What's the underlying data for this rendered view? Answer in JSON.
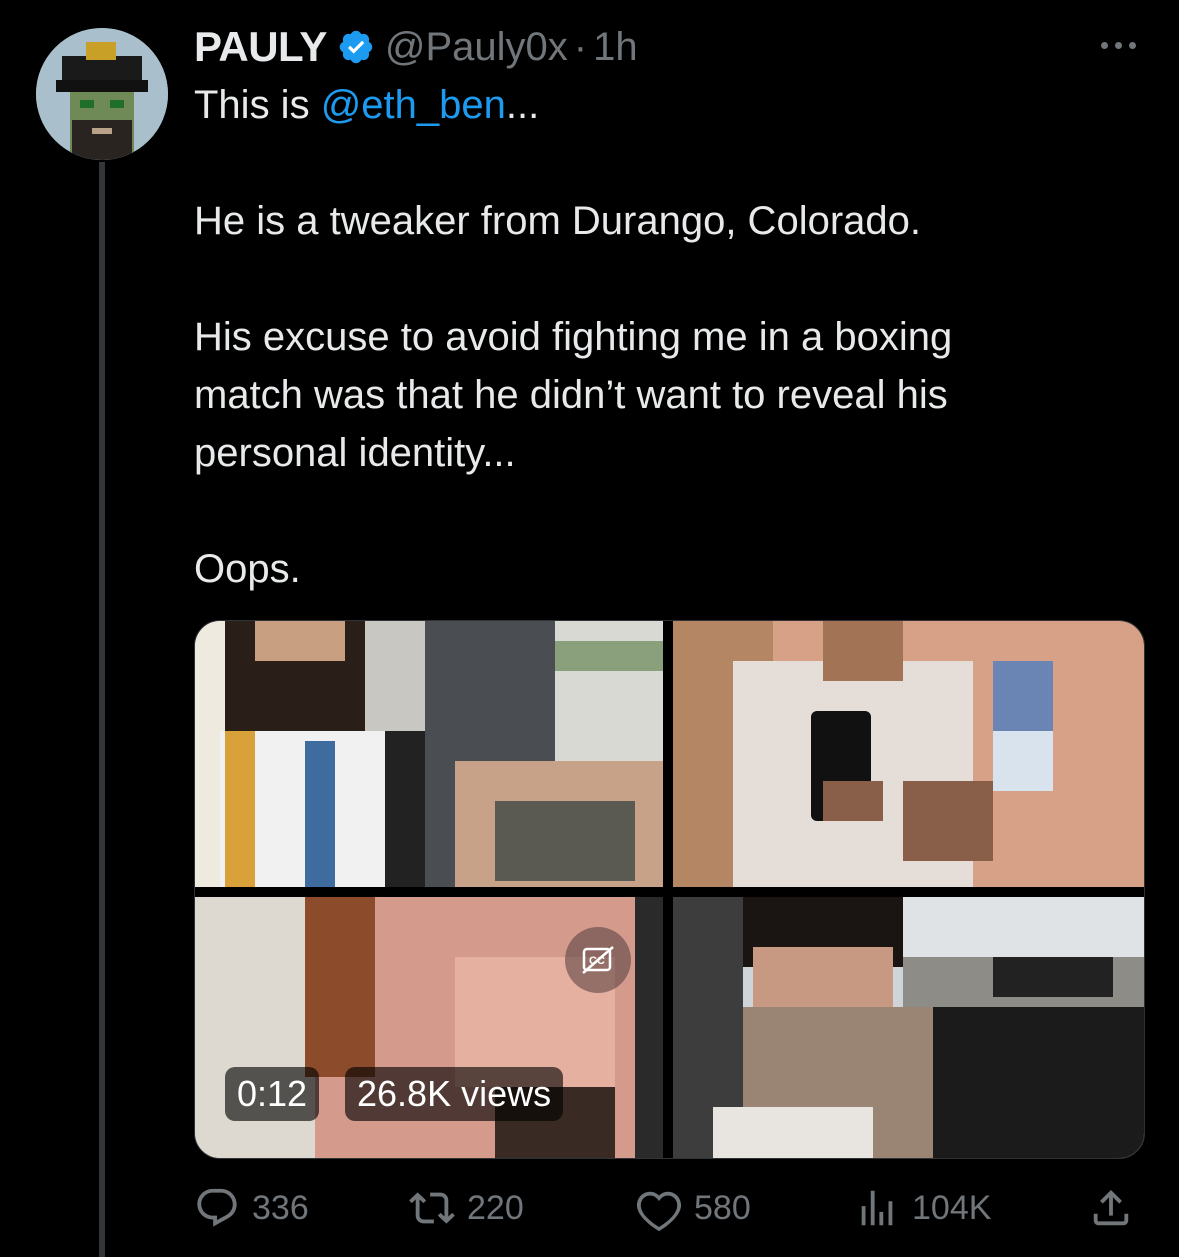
{
  "tweet": {
    "display_name": "PAULY",
    "verified": true,
    "handle": "@Pauly0x",
    "separator": "·",
    "time": "1h",
    "text": {
      "line1_prefix": "This is ",
      "line1_mention": "@eth_ben",
      "line1_suffix": "...",
      "para2": "He is a tweaker from Durango, Colorado.",
      "para3_line1": "His excuse to avoid fighting me in a boxing",
      "para3_line2": "match was that he didn’t want to reveal his",
      "para3_line3": "personal identity...",
      "para4": "Oops."
    }
  },
  "media": {
    "video": {
      "duration": "0:12",
      "views": "26.8K views"
    }
  },
  "actions": {
    "replies": "336",
    "retweets": "220",
    "likes": "580",
    "views": "104K"
  },
  "colors": {
    "background": "#000000",
    "text_primary": "#e7e9ea",
    "text_secondary": "#71767b",
    "accent": "#1d9bf0"
  },
  "icons": [
    "verified-badge-icon",
    "more-options-icon",
    "captions-off-icon",
    "reply-icon",
    "retweet-icon",
    "like-icon",
    "views-icon",
    "share-icon"
  ]
}
